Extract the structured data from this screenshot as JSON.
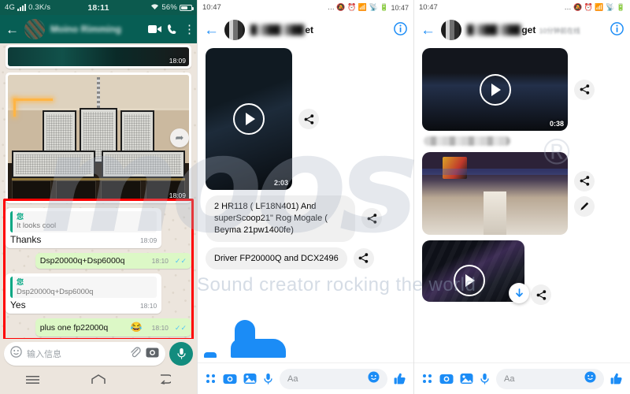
{
  "whatsapp": {
    "status": {
      "network": "4G",
      "speed": "0.3K/s",
      "time": "18:11",
      "battery": "56%"
    },
    "header": {
      "back_icon": "arrow-left-icon",
      "contact_name": "Moino Rimming",
      "video_icon": "video-call-icon",
      "call_icon": "phone-call-icon",
      "menu_icon": "overflow-menu-icon"
    },
    "messages": [
      {
        "type": "image",
        "kind": "video-strip",
        "time": "18:09"
      },
      {
        "type": "image",
        "kind": "speaker-stack-photo",
        "time": "18:09",
        "forward_icon": "forward-icon"
      },
      {
        "type": "in",
        "quote_name": "您",
        "quote_text": "It looks cool",
        "text": "Thanks",
        "time": "18:09"
      },
      {
        "type": "out",
        "text": "Dsp20000q+Dsp6000q",
        "time": "18:10",
        "ticks": "✓✓"
      },
      {
        "type": "in",
        "quote_name": "您",
        "quote_text": "Dsp20000q+Dsp6000q",
        "text": "Yes",
        "time": "18:10"
      },
      {
        "type": "out",
        "text": "plus one fp22000q",
        "emoji": "😂",
        "time": "18:10",
        "ticks": "✓✓"
      }
    ],
    "input": {
      "emoji_icon": "emoji-icon",
      "placeholder": "输入信息",
      "attach_icon": "paperclip-icon",
      "camera_icon": "camera-icon",
      "mic_icon": "microphone-icon"
    },
    "navbar": {
      "menu_icon": "recents-icon",
      "home_icon": "home-icon",
      "back_icon": "back-icon"
    }
  },
  "messenger_left": {
    "status": {
      "time_left": "10:47",
      "time_right": "10:47",
      "icons": "… 🔕 ⏰ 📶 📡 🔋"
    },
    "header": {
      "back_icon": "arrow-left-icon",
      "name_suffix": "et",
      "info_icon": "info-icon"
    },
    "messages": [
      {
        "type": "video",
        "duration": "2:03",
        "play_icon": "play-icon",
        "share_icon": "share-icon"
      },
      {
        "type": "text",
        "text": "2 HR118 ( LF18N401) And superScoop21\" Rog Mogale ( Beyma 21pw1400fe)",
        "share_icon": "share-icon"
      },
      {
        "type": "text",
        "text": "Driver FP20000Q and DCX2496",
        "share_icon": "share-icon"
      }
    ],
    "bar": {
      "apps_icon": "apps-grid-icon",
      "camera_icon": "camera-icon",
      "gallery_icon": "gallery-icon",
      "mic_icon": "microphone-icon",
      "placeholder": "Aa",
      "emoji_icon": "emoji-icon",
      "like_icon": "thumbs-up-icon"
    }
  },
  "messenger_right": {
    "status": {
      "time": "10:47",
      "icons": "… 🔕 ⏰ 📶 📡 🔋"
    },
    "header": {
      "back_icon": "arrow-left-icon",
      "name_suffix": "get",
      "status_text": "10分钟前在线",
      "info_icon": "info-icon"
    },
    "messages": [
      {
        "type": "video",
        "duration": "0:38",
        "play_icon": "play-icon",
        "share_icon": "share-icon"
      },
      {
        "type": "photo",
        "kind": "venue-interior",
        "share_icon": "share-icon",
        "pen_icon": "pen-icon",
        "react_icon": "add-reaction-icon"
      },
      {
        "type": "video",
        "duration": "",
        "play_icon": "play-icon",
        "download_icon": "download-icon",
        "share_icon": "share-icon"
      }
    ],
    "bar": {
      "apps_icon": "apps-grid-icon",
      "camera_icon": "camera-icon",
      "gallery_icon": "gallery-icon",
      "mic_icon": "microphone-icon",
      "placeholder": "Aa",
      "emoji_icon": "emoji-icon",
      "like_icon": "thumbs-up-icon"
    }
  },
  "watermark": {
    "logo": "moos",
    "tagline": "Sound creator rocking the world",
    "registered": "®"
  }
}
